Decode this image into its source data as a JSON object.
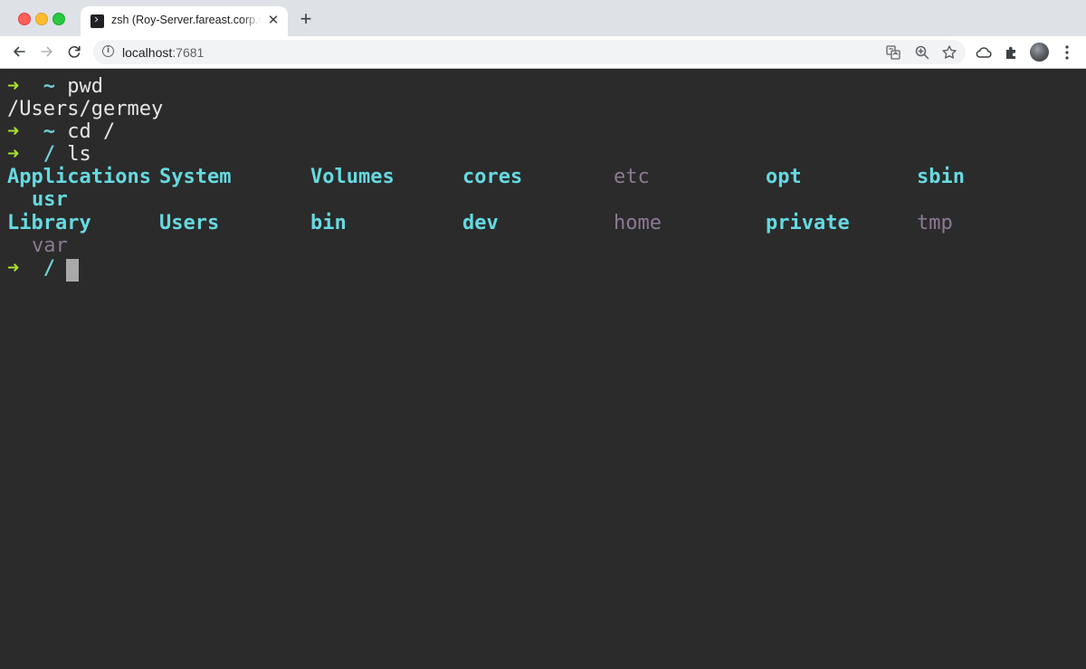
{
  "browser": {
    "tab": {
      "title": "zsh (Roy-Server.fareast.corp.microsoft.com)",
      "favicon": "terminal-icon",
      "close_label": "✕"
    },
    "new_tab_label": "+",
    "url": {
      "host": "localhost",
      "port": ":7681"
    },
    "toolbar_icons": [
      "back-icon",
      "forward-icon",
      "reload-icon",
      "info-icon",
      "translate-icon",
      "zoom-icon",
      "star-icon",
      "cloud-icon",
      "extensions-icon",
      "avatar",
      "menu-icon"
    ]
  },
  "terminal": {
    "prompt_arrow": "➜",
    "lines": [
      {
        "type": "prompt",
        "cwd": "~",
        "command": "pwd"
      },
      {
        "type": "output",
        "text": "/Users/germey"
      },
      {
        "type": "prompt",
        "cwd": "~",
        "command": "cd /"
      },
      {
        "type": "prompt",
        "cwd": "/",
        "command": "ls"
      }
    ],
    "ls_output": [
      [
        "Applications",
        "System",
        "Volumes",
        "cores",
        "etc",
        "opt",
        "sbin",
        "usr"
      ],
      [
        "Library",
        "Users",
        "bin",
        "dev",
        "home",
        "private",
        "tmp",
        "var"
      ]
    ],
    "final_prompt": {
      "cwd": "/"
    },
    "colors": {
      "background": "#2b2b2b",
      "arrow": "#a6e22e",
      "directory": "#66d9e0",
      "symlink": "#8c7a93",
      "text": "#e6e6e6"
    }
  }
}
